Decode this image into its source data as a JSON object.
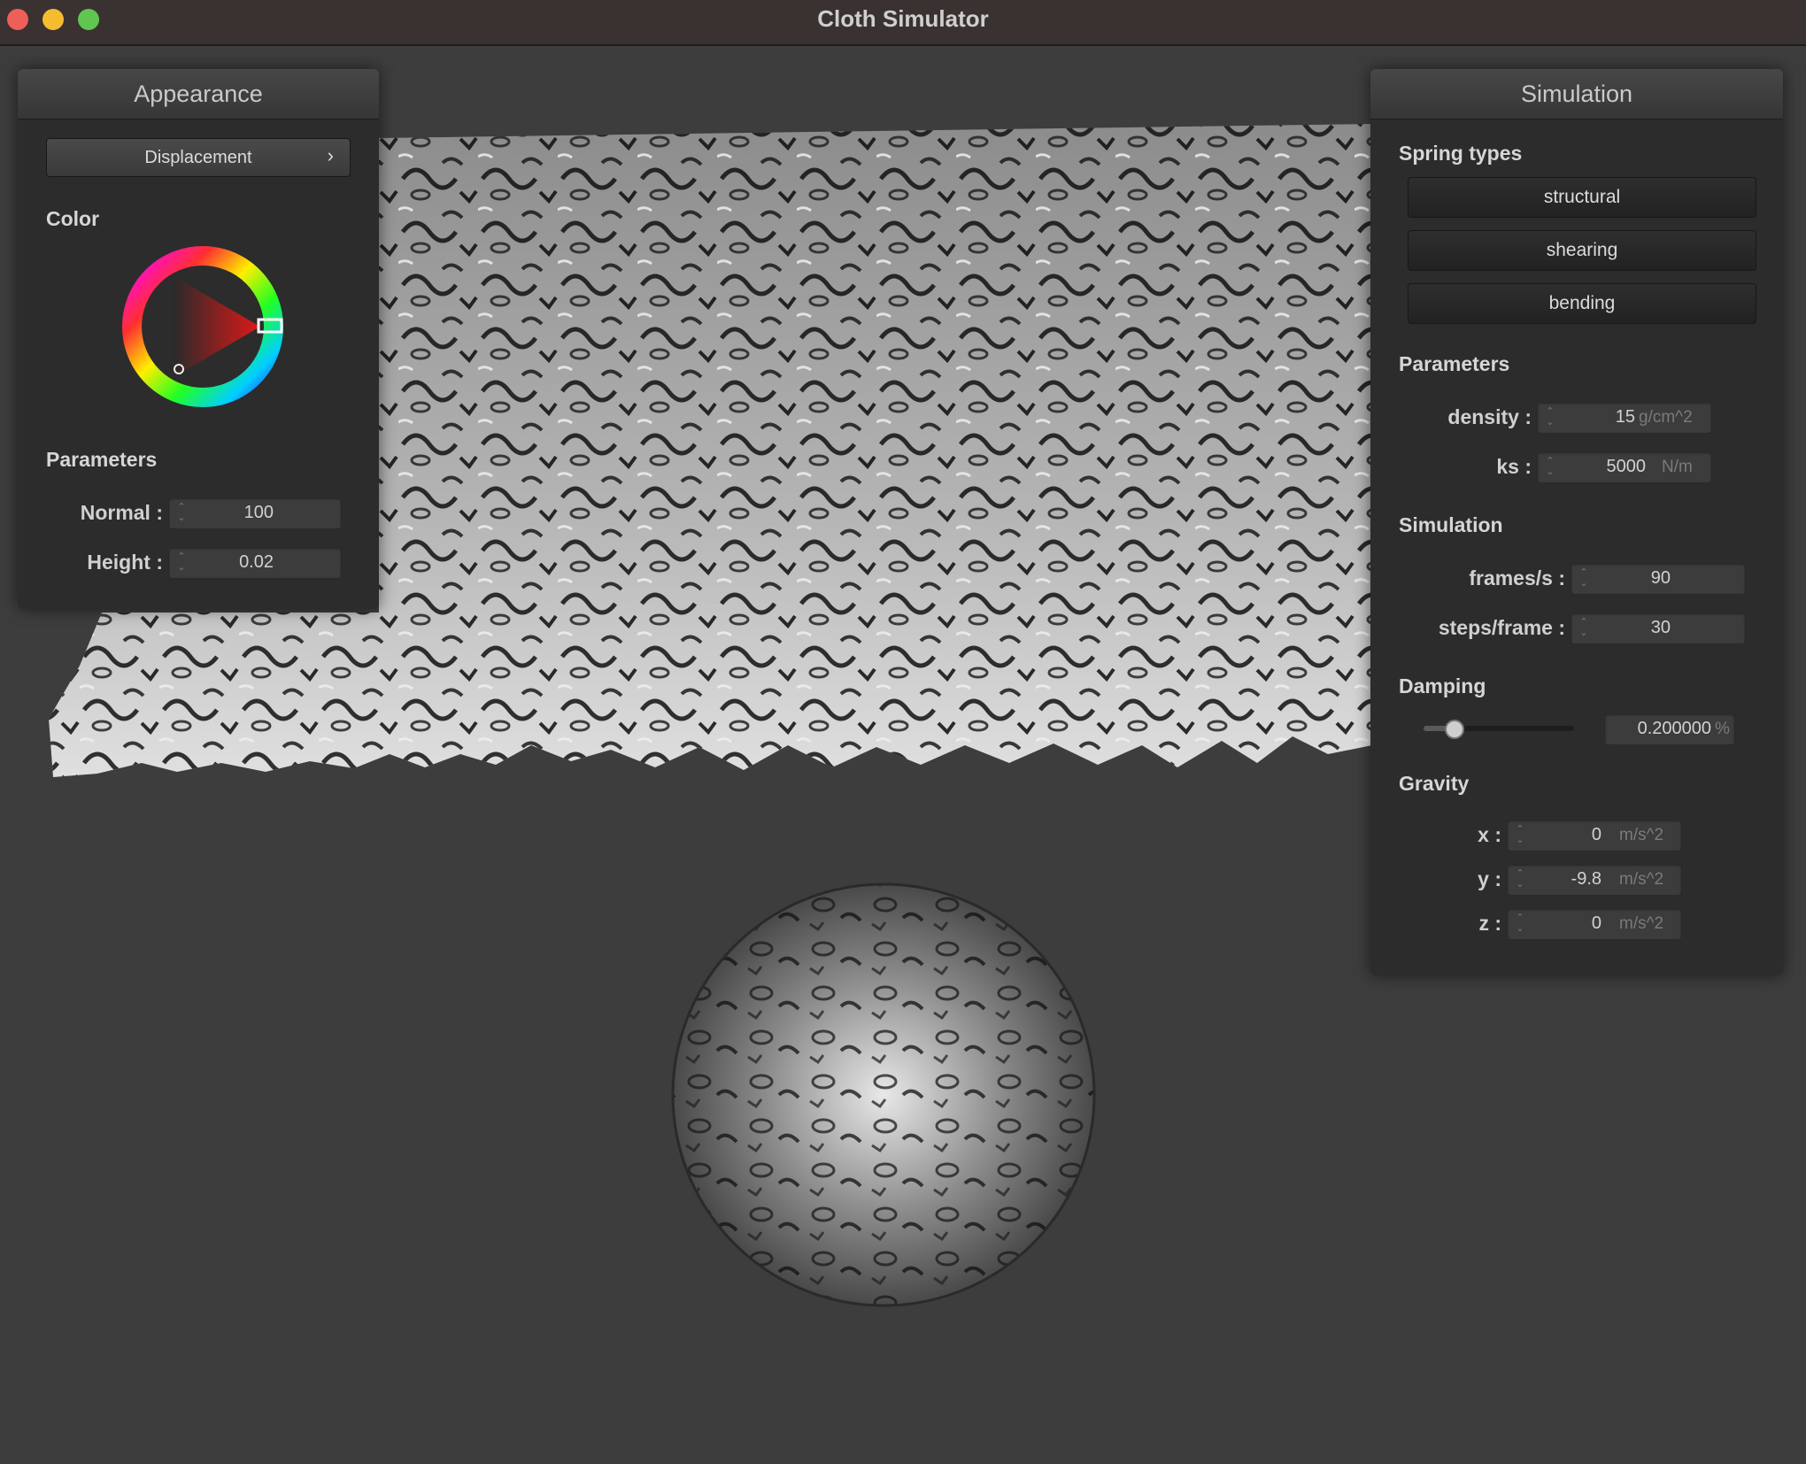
{
  "window": {
    "title": "Cloth Simulator"
  },
  "appearance": {
    "title": "Appearance",
    "shader_label": "Displacement",
    "shader_arrow": "›",
    "color_section": "Color",
    "params_section": "Parameters",
    "normal_label": "Normal :",
    "normal_value": "100",
    "height_label": "Height :",
    "height_value": "0.02"
  },
  "simulation": {
    "title": "Simulation",
    "spring_section": "Spring types",
    "spring_buttons": [
      "structural",
      "shearing",
      "bending"
    ],
    "params_section": "Parameters",
    "density_label": "density :",
    "density_value": "15",
    "density_unit": "g/cm^2",
    "ks_label": "ks :",
    "ks_value": "5000",
    "ks_unit": "N/m",
    "sim_section": "Simulation",
    "fps_label": "frames/s :",
    "fps_value": "90",
    "steps_label": "steps/frame :",
    "steps_value": "30",
    "damping_section": "Damping",
    "damping_value": "0.200000",
    "damping_unit": "%",
    "damping_slider": 0.2,
    "gravity_section": "Gravity",
    "gx_label": "x :",
    "gx_value": "0",
    "gy_label": "y :",
    "gy_value": "-9.8",
    "gz_label": "z :",
    "gz_value": "0",
    "gravity_unit": "m/s^2"
  },
  "colors": {
    "background": "#3d3d3d",
    "panel": "#2c2c2c",
    "color_wheel_selected": "#e03030"
  }
}
